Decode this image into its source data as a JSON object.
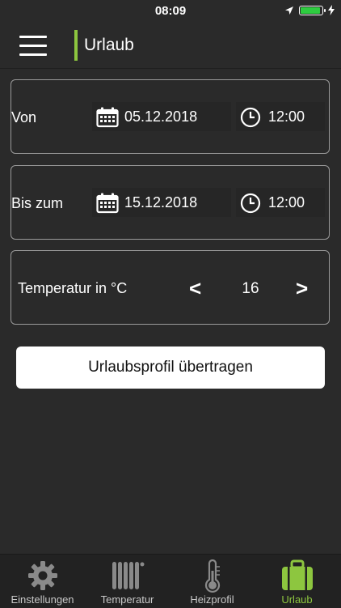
{
  "status_bar": {
    "time": "08:09"
  },
  "header": {
    "title": "Urlaub"
  },
  "from": {
    "label": "Von",
    "date": "05.12.2018",
    "time": "12:00"
  },
  "until": {
    "label": "Bis zum",
    "date": "15.12.2018",
    "time": "12:00"
  },
  "temperature": {
    "label": "Temperatur in °C",
    "value": "16",
    "decrease_label": "<",
    "increase_label": ">"
  },
  "submit_label": "Urlaubsprofil übertragen",
  "tabs": [
    {
      "label": "Einstellungen",
      "icon": "gear-icon"
    },
    {
      "label": "Temperatur",
      "icon": "radiator-icon"
    },
    {
      "label": "Heizprofil",
      "icon": "thermometer-icon"
    },
    {
      "label": "Urlaub",
      "icon": "suitcase-icon",
      "active": true
    }
  ],
  "colors": {
    "accent": "#8dc63f",
    "background": "#2a2a2a",
    "battery": "#2ecc40"
  }
}
